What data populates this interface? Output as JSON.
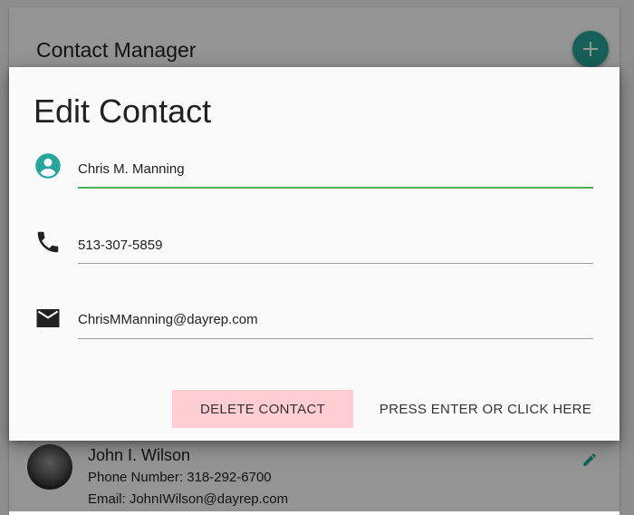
{
  "app": {
    "title": "Contact Manager",
    "fab_icon": "plus-icon"
  },
  "contacts": [
    {
      "name": "John I. Wilson",
      "phone": "Phone Number: 318-292-6700",
      "email": "Email: JohnIWilson@dayrep.com"
    }
  ],
  "modal": {
    "title": "Edit Contact",
    "fields": {
      "name": {
        "value": "Chris M. Manning",
        "icon": "account-circle-icon"
      },
      "phone": {
        "value": "513-307-5859",
        "icon": "phone-icon"
      },
      "email": {
        "value": "ChrisMManning@dayrep.com",
        "icon": "email-icon"
      }
    },
    "buttons": {
      "delete": "DELETE CONTACT",
      "save": "PRESS ENTER OR CLICK HERE"
    }
  },
  "colors": {
    "accent": "#26a69a",
    "active_underline": "#4caf50",
    "delete_bg": "#ffcdd2"
  }
}
